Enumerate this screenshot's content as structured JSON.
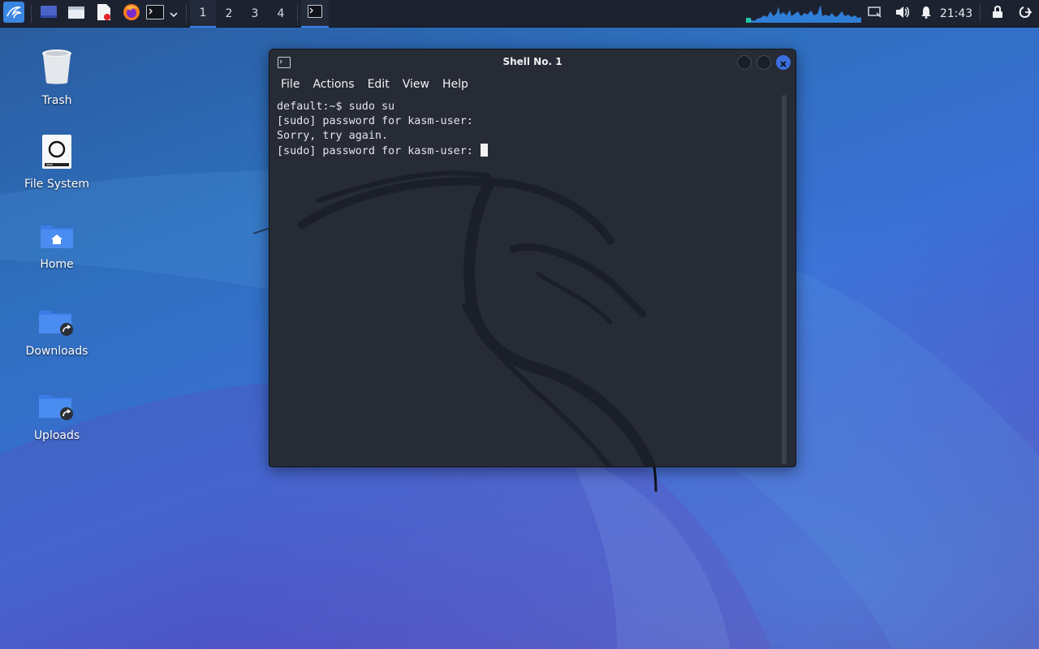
{
  "taskbar": {
    "workspaces": [
      "1",
      "2",
      "3",
      "4"
    ],
    "active_workspace": "1",
    "clock": "21:43",
    "icons": {
      "app_menu": "kali-dragon-icon",
      "show_desktop": "show-desktop-icon",
      "file_manager": "file-manager-icon",
      "text_editor": "text-editor-icon",
      "browser": "firefox-icon",
      "terminal": "terminal-icon",
      "dropdown": "chevron-down-icon",
      "running_terminal": "terminal-icon",
      "cpu_graph": "cpu-graph-icon",
      "network": "network-icon",
      "volume": "volume-icon",
      "notifications": "bell-icon",
      "lock": "lock-icon",
      "logout": "logout-icon"
    }
  },
  "desktop": {
    "icons": [
      {
        "label": "Trash",
        "icon": "trash-icon"
      },
      {
        "label": "File System",
        "icon": "drive-icon"
      },
      {
        "label": "Home",
        "icon": "home-folder-icon"
      },
      {
        "label": "Downloads",
        "icon": "folder-link-icon"
      },
      {
        "label": "Uploads",
        "icon": "folder-link-icon"
      }
    ]
  },
  "terminal": {
    "title": "Shell No. 1",
    "menu": [
      "File",
      "Actions",
      "Edit",
      "View",
      "Help"
    ],
    "lines": [
      "default:~$ sudo su",
      "[sudo] password for kasm-user:",
      "Sorry, try again.",
      "[sudo] password for kasm-user: "
    ]
  },
  "colors": {
    "accent": "#3b82e8",
    "taskbar_bg": "#1d2230",
    "terminal_bg": "#262b35",
    "close_button": "#3b6fe0"
  }
}
